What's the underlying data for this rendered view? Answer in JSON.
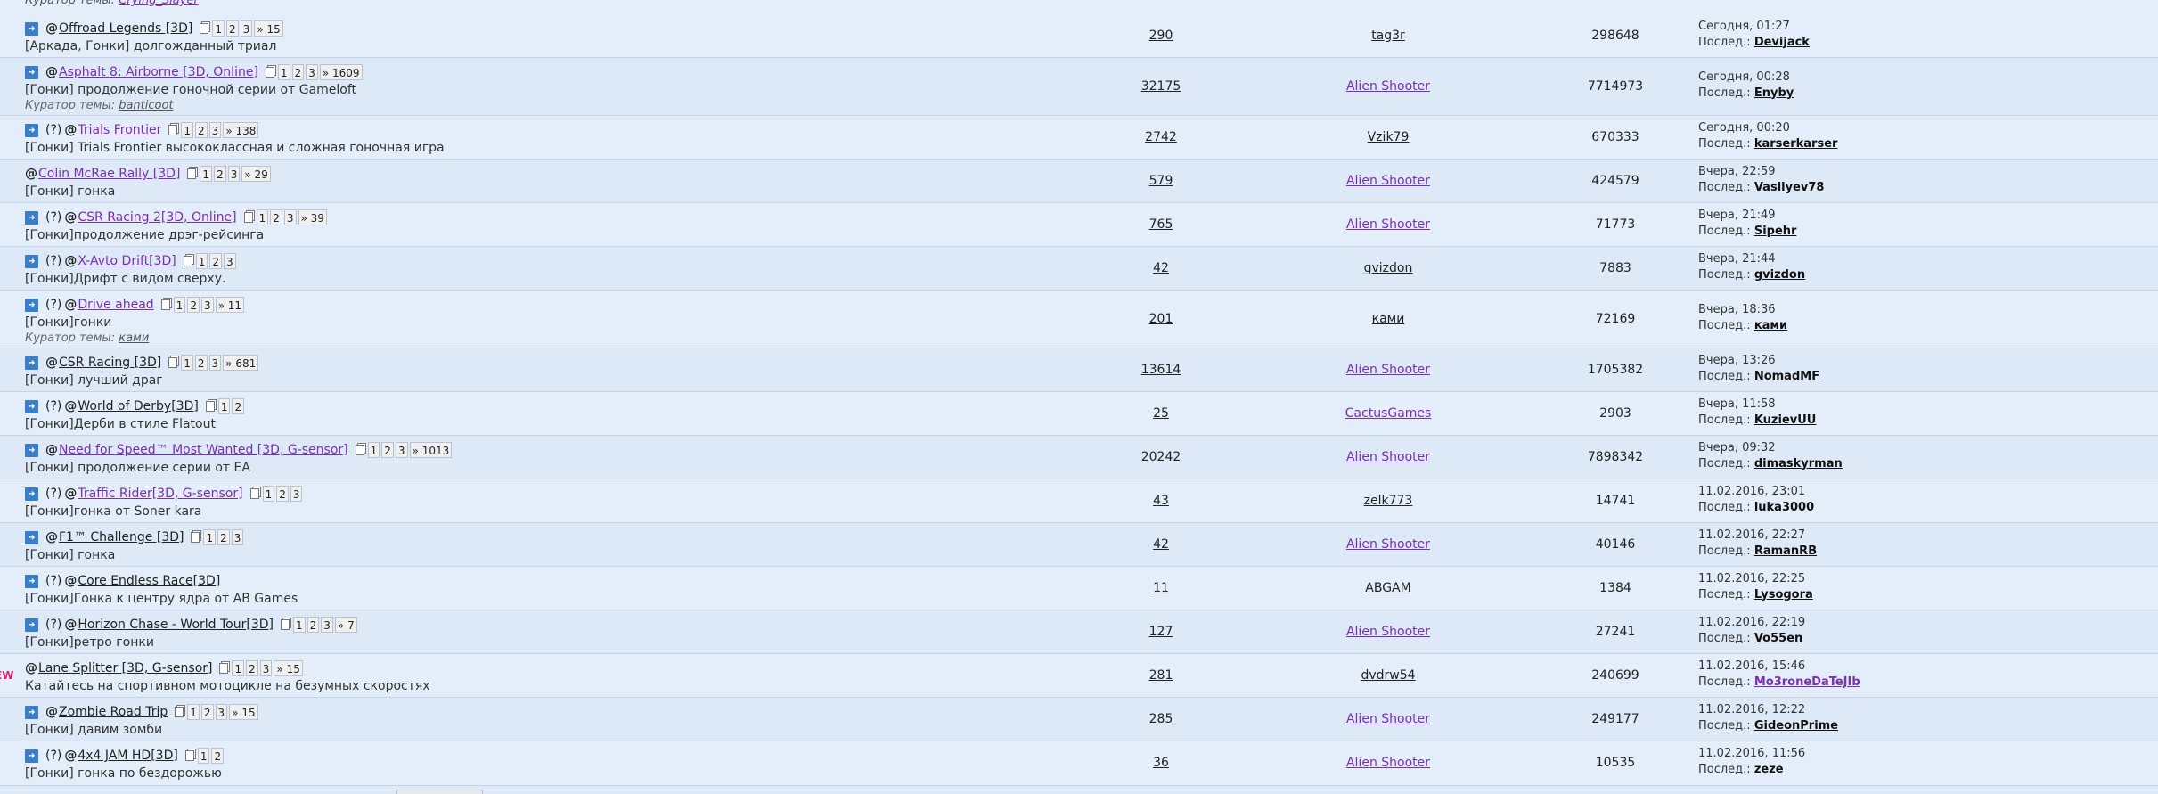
{
  "curator_top": {
    "label": "Куратор темы:",
    "name": "Crying_Slayer"
  },
  "topics": [
    {
      "q": false,
      "title": "Offroad Legends [3D]",
      "visited": false,
      "last_page": "» 15",
      "desc": "[Аркада, Гонки] долгожданный триал",
      "curator_label": "",
      "curator": "",
      "replies": "290",
      "author": "tag3r",
      "author_purple": false,
      "views": "298648",
      "last_time": "Сегодня, 01:27",
      "last_label": "Послед.:",
      "last_by": "Devijack",
      "last_by_purple": false,
      "new": ""
    },
    {
      "q": false,
      "title": "Asphalt 8: Airborne [3D, Online]",
      "visited": true,
      "last_page": "» 1609",
      "desc": "[Гонки] продолжение гоночной серии от Gameloft",
      "curator_label": "Куратор темы:",
      "curator": "banticoot",
      "replies": "32175",
      "author": "Alien Shooter",
      "author_purple": true,
      "views": "7714973",
      "last_time": "Сегодня, 00:28",
      "last_label": "Послед.:",
      "last_by": "Enyby",
      "last_by_purple": false,
      "new": ""
    },
    {
      "q": true,
      "title": "Trials Frontier",
      "visited": true,
      "last_page": "» 138",
      "desc": "[Гонки] Trials Frontier высококлассная и сложная гоночная игра",
      "curator_label": "",
      "curator": "",
      "replies": "2742",
      "author": "Vzik79",
      "author_purple": false,
      "views": "670333",
      "last_time": "Сегодня, 00:20",
      "last_label": "Послед.:",
      "last_by": "karserkarser",
      "last_by_purple": false,
      "new": ""
    },
    {
      "q": false,
      "noarrow": true,
      "title": "Colin McRae Rally [3D]",
      "visited": true,
      "last_page": "» 29",
      "desc": "[Гонки] гонка",
      "curator_label": "",
      "curator": "",
      "replies": "579",
      "author": "Alien Shooter",
      "author_purple": true,
      "views": "424579",
      "last_time": "Вчера, 22:59",
      "last_label": "Послед.:",
      "last_by": "Vasilyev78",
      "last_by_purple": false,
      "new": ""
    },
    {
      "q": true,
      "title": "CSR Racing 2[3D, Online]",
      "visited": true,
      "last_page": "» 39",
      "desc": "[Гонки]продолжение дрэг-рейсинга",
      "curator_label": "",
      "curator": "",
      "replies": "765",
      "author": "Alien Shooter",
      "author_purple": true,
      "views": "71773",
      "last_time": "Вчера, 21:49",
      "last_label": "Послед.:",
      "last_by": "Sipehr",
      "last_by_purple": false,
      "new": ""
    },
    {
      "q": true,
      "title": "X-Avto Drift[3D]",
      "visited": true,
      "last_page": "",
      "desc": "[Гонки]Дрифт с видом сверху.",
      "curator_label": "",
      "curator": "",
      "replies": "42",
      "author": "gvizdon",
      "author_purple": false,
      "views": "7883",
      "last_time": "Вчера, 21:44",
      "last_label": "Послед.:",
      "last_by": "gvizdon",
      "last_by_purple": false,
      "new": ""
    },
    {
      "q": true,
      "title": "Drive ahead",
      "visited": true,
      "last_page": "» 11",
      "desc": "[Гонки]гонки",
      "curator_label": "Куратор темы:",
      "curator": "ками",
      "replies": "201",
      "author": "ками",
      "author_purple": false,
      "views": "72169",
      "last_time": "Вчера, 18:36",
      "last_label": "Послед.:",
      "last_by": "ками",
      "last_by_purple": false,
      "new": ""
    },
    {
      "q": false,
      "title": "CSR Racing [3D]",
      "visited": false,
      "last_page": "» 681",
      "desc": "[Гонки] лучший драг",
      "curator_label": "",
      "curator": "",
      "replies": "13614",
      "author": "Alien Shooter",
      "author_purple": true,
      "views": "1705382",
      "last_time": "Вчера, 13:26",
      "last_label": "Послед.:",
      "last_by": "NomadMF",
      "last_by_purple": false,
      "new": ""
    },
    {
      "q": true,
      "title": "World of Derby[3D]",
      "visited": false,
      "last_page": "",
      "pages_two": true,
      "desc": "[Гонки]Дерби в стиле Flatout",
      "curator_label": "",
      "curator": "",
      "replies": "25",
      "author": "CactusGames",
      "author_purple": true,
      "views": "2903",
      "last_time": "Вчера, 11:58",
      "last_label": "Послед.:",
      "last_by": "KuzievUU",
      "last_by_purple": false,
      "new": ""
    },
    {
      "q": false,
      "title": "Need for Speed™ Most Wanted [3D, G-sensor]",
      "visited": true,
      "last_page": "» 1013",
      "desc": "[Гонки] продолжение серии от EA",
      "curator_label": "",
      "curator": "",
      "replies": "20242",
      "author": "Alien Shooter",
      "author_purple": true,
      "views": "7898342",
      "last_time": "Вчера, 09:32",
      "last_label": "Послед.:",
      "last_by": "dimaskyrman",
      "last_by_purple": false,
      "new": ""
    },
    {
      "q": true,
      "title": "Traffic Rider[3D, G-sensor]",
      "visited": true,
      "last_page": "",
      "desc": "[Гонки]гонка от Soner kara",
      "curator_label": "",
      "curator": "",
      "replies": "43",
      "author": "zelk773",
      "author_purple": false,
      "views": "14741",
      "last_time": "11.02.2016, 23:01",
      "last_label": "Послед.:",
      "last_by": "luka3000",
      "last_by_purple": false,
      "new": ""
    },
    {
      "q": false,
      "title": "F1™ Challenge [3D]",
      "visited": false,
      "last_page": "",
      "desc": "[Гонки] гонка",
      "curator_label": "",
      "curator": "",
      "replies": "42",
      "author": "Alien Shooter",
      "author_purple": true,
      "views": "40146",
      "last_time": "11.02.2016, 22:27",
      "last_label": "Послед.:",
      "last_by": "RamanRB",
      "last_by_purple": false,
      "new": ""
    },
    {
      "q": true,
      "title": "Core Endless Race[3D]",
      "visited": false,
      "last_page": "",
      "no_pages": true,
      "desc": "[Гонки]Гонка к центру ядра от AB Games",
      "curator_label": "",
      "curator": "",
      "replies": "11",
      "author": "ABGAM",
      "author_purple": false,
      "views": "1384",
      "last_time": "11.02.2016, 22:25",
      "last_label": "Послед.:",
      "last_by": "Lysogora",
      "last_by_purple": false,
      "new": ""
    },
    {
      "q": true,
      "title": "Horizon Chase - World Tour[3D]",
      "visited": false,
      "last_page": "» 7",
      "desc": "[Гонки]ретро гонки",
      "curator_label": "",
      "curator": "",
      "replies": "127",
      "author": "Alien Shooter",
      "author_purple": true,
      "views": "27241",
      "last_time": "11.02.2016, 22:19",
      "last_label": "Послед.:",
      "last_by": "Vo55en",
      "last_by_purple": false,
      "new": ""
    },
    {
      "q": false,
      "noarrow": true,
      "title": "Lane Splitter [3D, G-sensor]",
      "visited": false,
      "last_page": "» 15",
      "desc": "Катайтесь на спортивном мотоцикле на безумных скоростях",
      "curator_label": "",
      "curator": "",
      "replies": "281",
      "author": "dvdrw54",
      "author_purple": false,
      "views": "240699",
      "last_time": "11.02.2016, 15:46",
      "last_label": "Послед.:",
      "last_by": "Mo3roneDaTeJIb",
      "last_by_purple": true,
      "new": "EW"
    },
    {
      "q": false,
      "title": "Zombie Road Trip",
      "visited": false,
      "last_page": "» 15",
      "desc": "[Гонки] давим зомби",
      "curator_label": "",
      "curator": "",
      "replies": "285",
      "author": "Alien Shooter",
      "author_purple": true,
      "views": "249177",
      "last_time": "11.02.2016, 12:22",
      "last_label": "Послед.:",
      "last_by": "GideonPrime",
      "last_by_purple": false,
      "new": ""
    },
    {
      "q": true,
      "title": "4x4 JAM HD[3D]",
      "visited": false,
      "last_page": "",
      "pages_two": true,
      "desc": "[Гонки] гонка по бездорожью",
      "curator_label": "",
      "curator": "",
      "replies": "36",
      "author": "Alien Shooter",
      "author_purple": true,
      "views": "10535",
      "last_time": "11.02.2016, 11:56",
      "last_label": "Послед.:",
      "last_by": "zeze",
      "last_by_purple": false,
      "new": ""
    }
  ],
  "q_mark": "(?)",
  "attach_mark": "@",
  "pages": [
    "1",
    "2",
    "3"
  ],
  "arrow_glyph": "➜"
}
